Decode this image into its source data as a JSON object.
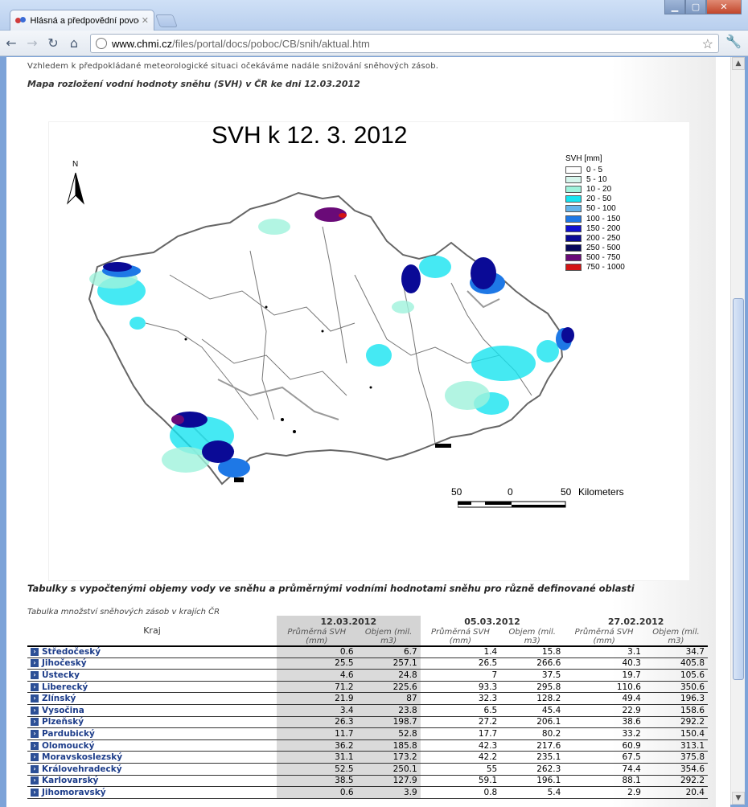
{
  "browser": {
    "tab_title": "Hlásná a předpovědní povodňová služba",
    "url_host": "www.chmi.cz",
    "url_path": "/files/portal/docs/poboc/CB/snih/aktual.htm"
  },
  "page": {
    "intro": "Vzhledem k předpokládané meteorologické situaci očekáváme nadále snižování sněhových zásob.",
    "map_heading": "Mapa rozložení vodní hodnoty sněhu (SVH) v ČR ke dni 12.03.2012",
    "tables_heading": "Tabulky s vypočtenými objemy vody ve sněhu a průměrnými vodními hodnotami sněhu pro různě definované oblasti",
    "table_caption": "Tabulka množství sněhových zásob v krajích ČR"
  },
  "map": {
    "title": "SVH k 12. 3. 2012",
    "north_label": "N",
    "legend_title": "SVH [mm]",
    "legend": [
      {
        "label": "0 - 5",
        "color": "#ffffff"
      },
      {
        "label": "5 - 10",
        "color": "#d6f5ec"
      },
      {
        "label": "10 - 20",
        "color": "#9ff2dc"
      },
      {
        "label": "20 - 50",
        "color": "#17e4f0"
      },
      {
        "label": "50 - 100",
        "color": "#64b4ea"
      },
      {
        "label": "100 - 150",
        "color": "#1e78e6"
      },
      {
        "label": "150 - 200",
        "color": "#1010d0"
      },
      {
        "label": "200 - 250",
        "color": "#0a0a96"
      },
      {
        "label": "250 - 500",
        "color": "#08085a"
      },
      {
        "label": "500 - 750",
        "color": "#6a0a78"
      },
      {
        "label": "750 - 1000",
        "color": "#d41414"
      }
    ],
    "scale_left": "50",
    "scale_mid": "0",
    "scale_right": "50",
    "scale_unit": "Kilometers"
  },
  "table": {
    "col_kraj": "Kraj",
    "dates": [
      "12.03.2012",
      "05.03.2012",
      "27.02.2012"
    ],
    "sub_svh": "Průměrná SVH (mm)",
    "sub_objem": "Objem (mil. m3)",
    "rows": [
      {
        "kraj": "Středočeský",
        "v": [
          "0.6",
          "6.7",
          "1.4",
          "15.8",
          "3.1",
          "34.7"
        ]
      },
      {
        "kraj": "Jihočeský",
        "v": [
          "25.5",
          "257.1",
          "26.5",
          "266.6",
          "40.3",
          "405.8"
        ]
      },
      {
        "kraj": "Ústecky",
        "v": [
          "4.6",
          "24.8",
          "7",
          "37.5",
          "19.7",
          "105.6"
        ]
      },
      {
        "kraj": "Liberecký",
        "v": [
          "71.2",
          "225.6",
          "93.3",
          "295.8",
          "110.6",
          "350.6"
        ]
      },
      {
        "kraj": "Zlínský",
        "v": [
          "21.9",
          "87",
          "32.3",
          "128.2",
          "49.4",
          "196.3"
        ]
      },
      {
        "kraj": "Vysočina",
        "v": [
          "3.4",
          "23.8",
          "6.5",
          "45.4",
          "22.9",
          "158.6"
        ]
      },
      {
        "kraj": "Plzeňský",
        "v": [
          "26.3",
          "198.7",
          "27.2",
          "206.1",
          "38.6",
          "292.2"
        ]
      },
      {
        "kraj": "Pardubický",
        "v": [
          "11.7",
          "52.8",
          "17.7",
          "80.2",
          "33.2",
          "150.4"
        ]
      },
      {
        "kraj": "Olomoucký",
        "v": [
          "36.2",
          "185.8",
          "42.3",
          "217.6",
          "60.9",
          "313.1"
        ]
      },
      {
        "kraj": "Moravskoslezský",
        "v": [
          "31.1",
          "173.2",
          "42.2",
          "235.1",
          "67.5",
          "375.8"
        ]
      },
      {
        "kraj": "Královehradecký",
        "v": [
          "52.5",
          "250.1",
          "55",
          "262.3",
          "74.4",
          "354.6"
        ]
      },
      {
        "kraj": "Karlovarský",
        "v": [
          "38.5",
          "127.9",
          "59.1",
          "196.1",
          "88.1",
          "292.2"
        ]
      },
      {
        "kraj": "Jihomoravský",
        "v": [
          "0.6",
          "3.9",
          "0.8",
          "5.4",
          "2.9",
          "20.4"
        ]
      }
    ]
  }
}
